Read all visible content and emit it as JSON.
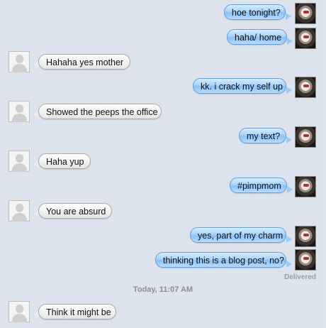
{
  "messages": [
    {
      "dir": "out",
      "text": "hoe tonight?"
    },
    {
      "dir": "out",
      "text": "haha/ home"
    },
    {
      "dir": "in",
      "text": "Hahaha yes mother"
    },
    {
      "dir": "out",
      "text": "kk. i crack my self up"
    },
    {
      "dir": "in",
      "text": "Showed the peeps the office"
    },
    {
      "dir": "out",
      "text": "my text?"
    },
    {
      "dir": "in",
      "text": "Haha yup"
    },
    {
      "dir": "out",
      "text": "#pimpmom"
    },
    {
      "dir": "in",
      "text": "You are absurd"
    },
    {
      "dir": "out",
      "text": "yes, part of my charm"
    },
    {
      "dir": "out",
      "text": "thinking this is a blog post, no?"
    },
    {
      "dir": "in",
      "text": "Think it might be"
    }
  ],
  "status": {
    "delivered": "Delivered"
  },
  "timestamp": "Today, 11:07 AM",
  "colors": {
    "outgoing_bubble": "#a8d3fb",
    "incoming_bubble": "#f3f3f3",
    "background": "#dbe2ec"
  }
}
